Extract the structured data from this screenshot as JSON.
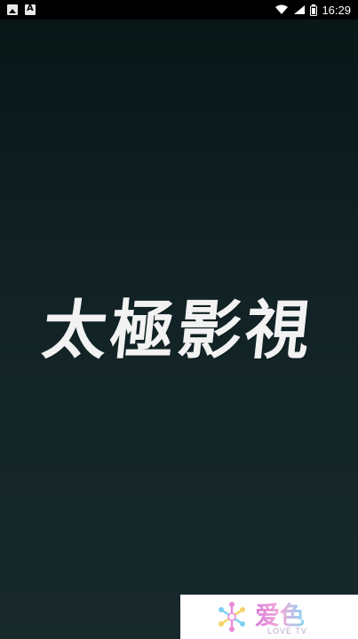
{
  "status_bar": {
    "time": "16:29",
    "icons": [
      "image-notification-icon",
      "font-notification-icon",
      "wifi-icon",
      "signal-icon",
      "battery-icon"
    ]
  },
  "splash": {
    "logo_text": "太極影視"
  },
  "footer_brand": {
    "name_cn": "爱色",
    "name_en": "LOVE TV",
    "colors": {
      "pink": "#e88ad7",
      "blue": "#7fd0f0",
      "yellow": "#f3d36c"
    }
  },
  "colors": {
    "background_top": "#081616",
    "background_bottom": "#18292c",
    "status_bar": "#000000",
    "logo_text": "#f2f2f2"
  }
}
